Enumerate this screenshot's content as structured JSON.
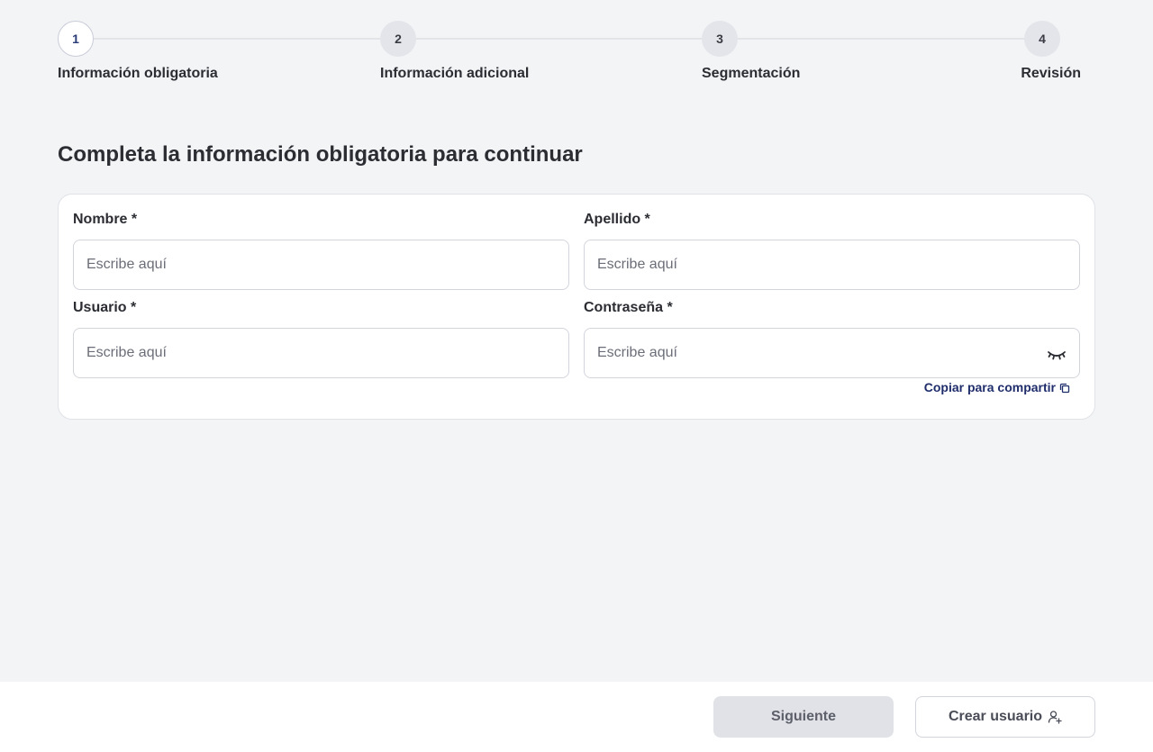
{
  "stepper": {
    "steps": [
      {
        "number": "1",
        "label": "Información obligatoria",
        "active": true
      },
      {
        "number": "2",
        "label": "Información adicional",
        "active": false
      },
      {
        "number": "3",
        "label": "Segmentación",
        "active": false
      },
      {
        "number": "4",
        "label": "Revisión",
        "active": false
      }
    ]
  },
  "page": {
    "title": "Completa la información obligatoria para continuar"
  },
  "form": {
    "nombre": {
      "label": "Nombre *",
      "placeholder": "Escribe aquí",
      "value": ""
    },
    "apellido": {
      "label": "Apellido *",
      "placeholder": "Escribe aquí",
      "value": ""
    },
    "usuario": {
      "label": "Usuario *",
      "placeholder": "Escribe aquí",
      "value": ""
    },
    "contrasena": {
      "label": "Contraseña *",
      "placeholder": "Escribe aquí",
      "value": "",
      "icon": "eye-closed-icon"
    },
    "copy_link": {
      "label": "Copiar para compartir",
      "icon": "copy-icon"
    }
  },
  "footer": {
    "next_label": "Siguiente",
    "create_label": "Crear usuario",
    "create_icon": "user-plus-icon"
  },
  "colors": {
    "background": "#f3f4f6",
    "accent": "#1f2d6b",
    "disabled_button": "#e1e2e7"
  }
}
